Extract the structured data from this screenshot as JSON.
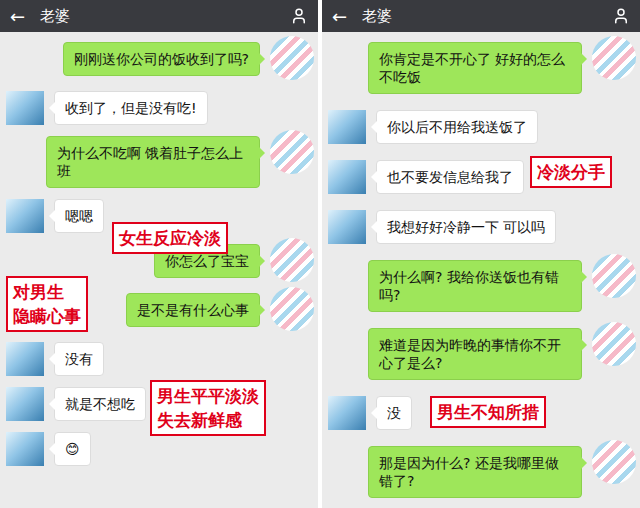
{
  "panels": [
    {
      "back": "←",
      "title": "老婆",
      "messages": [
        {
          "side": "right",
          "text": "刚刚送你公司的饭收到了吗?"
        },
        {
          "side": "left",
          "text": "收到了，但是没有吃!"
        },
        {
          "side": "right",
          "text": "为什么不吃啊 饿着肚子怎么上班"
        },
        {
          "side": "left",
          "text": "嗯嗯"
        },
        {
          "side": "right",
          "text": "你怎么了宝宝"
        },
        {
          "side": "right",
          "text": "是不是有什么心事"
        },
        {
          "side": "left",
          "text": "没有"
        },
        {
          "side": "left",
          "text": "就是不想吃"
        },
        {
          "side": "left",
          "text": "😊"
        }
      ],
      "annotations": [
        {
          "lines": [
            "女生反应冷淡"
          ]
        },
        {
          "lines": [
            "对男生",
            "隐瞒心事"
          ]
        },
        {
          "lines": [
            "男生平平淡淡",
            "失去新鲜感"
          ]
        }
      ]
    },
    {
      "back": "←",
      "title": "老婆",
      "messages": [
        {
          "side": "right",
          "text": "你肯定是不开心了 好好的怎么不吃饭"
        },
        {
          "side": "left",
          "text": "你以后不用给我送饭了"
        },
        {
          "side": "left",
          "text": "也不要发信息给我了"
        },
        {
          "side": "left",
          "text": "我想好好冷静一下 可以吗"
        },
        {
          "side": "right",
          "text": "为什么啊? 我给你送饭也有错吗?"
        },
        {
          "side": "right",
          "text": "难道是因为昨晚的事情你不开心了是么?"
        },
        {
          "side": "left",
          "text": "没"
        },
        {
          "side": "right",
          "text": "那是因为什么? 还是我哪里做错了?"
        }
      ],
      "annotations": [
        {
          "lines": [
            "冷淡分手"
          ]
        },
        {
          "lines": [
            "男生不知所措"
          ]
        }
      ]
    }
  ]
}
